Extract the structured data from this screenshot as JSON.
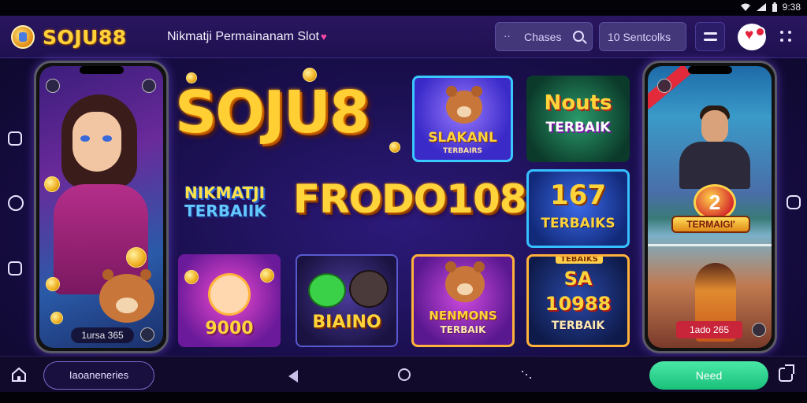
{
  "status_bar": {
    "time": "9:38"
  },
  "header": {
    "brand": "SOJU88",
    "tagline": "Nikmatji Permainanam Slot",
    "tagline_heart": "♥",
    "search": {
      "label": "Chases",
      "dash": "··"
    },
    "settings_label": "10  Sentcolks"
  },
  "hero": {
    "logo": "SOJU8",
    "left_text_line1": "NIKMATJI",
    "left_text_line2": "TERBAIIK",
    "headline": "FRODO108"
  },
  "phone_left": {
    "label": "1ursa 365"
  },
  "phone_right": {
    "badge": "2",
    "banner": "TERMAIGI'",
    "label": "1ado 265"
  },
  "tiles": [
    {
      "line1": "SLAKANL",
      "line2": "TERBAIRS"
    },
    {
      "line1": "Nouts",
      "line2": "TERBAIK"
    },
    {
      "line1": "167",
      "line2": "TERBAIKS"
    },
    {
      "line1": "9000"
    },
    {
      "line1": "BIAINO"
    },
    {
      "line1": "NENMONS",
      "line2": "TERBAIK"
    },
    {
      "banner": "TEBAIKS",
      "line1": "SA",
      "line2": "10988",
      "line3": "TERBAIK"
    }
  ],
  "bottom_nav": {
    "left_button": "Iaoaneneries",
    "right_button": "Need"
  }
}
